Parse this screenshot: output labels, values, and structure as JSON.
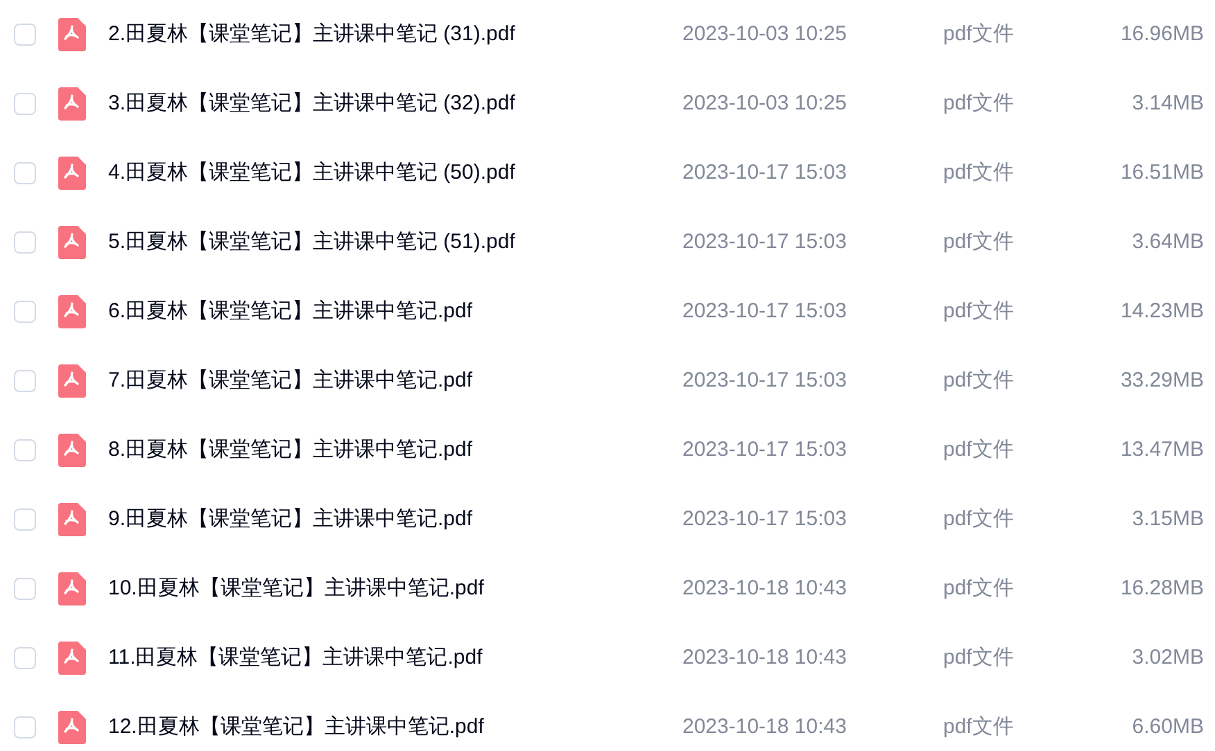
{
  "files": [
    {
      "name": "2.田夏林【课堂笔记】主讲课中笔记 (31).pdf",
      "date": "2023-10-03 10:25",
      "type": "pdf文件",
      "size": "16.96MB",
      "checked": false
    },
    {
      "name": "3.田夏林【课堂笔记】主讲课中笔记 (32).pdf",
      "date": "2023-10-03 10:25",
      "type": "pdf文件",
      "size": "3.14MB",
      "checked": false
    },
    {
      "name": "4.田夏林【课堂笔记】主讲课中笔记 (50).pdf",
      "date": "2023-10-17 15:03",
      "type": "pdf文件",
      "size": "16.51MB",
      "checked": false
    },
    {
      "name": "5.田夏林【课堂笔记】主讲课中笔记 (51).pdf",
      "date": "2023-10-17 15:03",
      "type": "pdf文件",
      "size": "3.64MB",
      "checked": false
    },
    {
      "name": "6.田夏林【课堂笔记】主讲课中笔记.pdf",
      "date": "2023-10-17 15:03",
      "type": "pdf文件",
      "size": "14.23MB",
      "checked": false
    },
    {
      "name": "7.田夏林【课堂笔记】主讲课中笔记.pdf",
      "date": "2023-10-17 15:03",
      "type": "pdf文件",
      "size": "33.29MB",
      "checked": false
    },
    {
      "name": "8.田夏林【课堂笔记】主讲课中笔记.pdf",
      "date": "2023-10-17 15:03",
      "type": "pdf文件",
      "size": "13.47MB",
      "checked": false
    },
    {
      "name": "9.田夏林【课堂笔记】主讲课中笔记.pdf",
      "date": "2023-10-17 15:03",
      "type": "pdf文件",
      "size": "3.15MB",
      "checked": false
    },
    {
      "name": "10.田夏林【课堂笔记】主讲课中笔记.pdf",
      "date": "2023-10-18 10:43",
      "type": "pdf文件",
      "size": "16.28MB",
      "checked": false
    },
    {
      "name": "11.田夏林【课堂笔记】主讲课中笔记.pdf",
      "date": "2023-10-18 10:43",
      "type": "pdf文件",
      "size": "3.02MB",
      "checked": false
    },
    {
      "name": "12.田夏林【课堂笔记】主讲课中笔记.pdf",
      "date": "2023-10-18 10:43",
      "type": "pdf文件",
      "size": "6.60MB",
      "checked": false
    }
  ]
}
